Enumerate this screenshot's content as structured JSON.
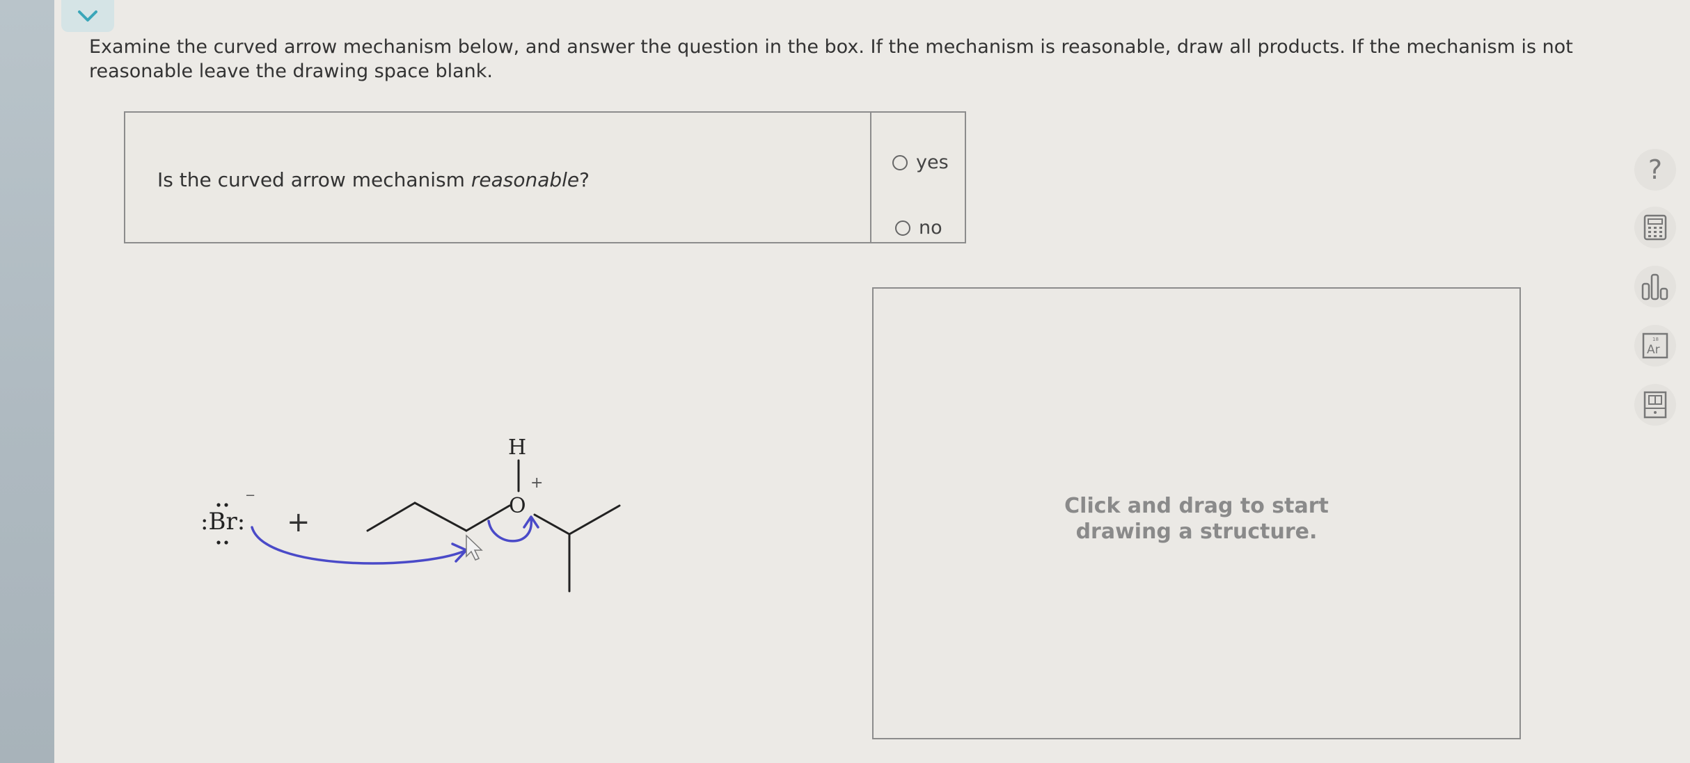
{
  "instructions": "Examine the curved arrow mechanism below, and answer the question in the box. If the mechanism is reasonable, draw all products. If the mechanism is not reasonable leave the drawing space blank.",
  "question": {
    "prefix": "Is the curved arrow mechanism ",
    "emphasis": "reasonable",
    "suffix": "?",
    "options": [
      {
        "label": "yes",
        "selected": false
      },
      {
        "label": "no",
        "selected": false
      }
    ]
  },
  "mechanism": {
    "bromide": ":Br:",
    "bromide_charge": "−",
    "plus_sign": "+",
    "hydrogen": "H",
    "oxygen": "O",
    "oxygen_charge": "+"
  },
  "drawing_area": {
    "prompt_line1": "Click and drag to start",
    "prompt_line2": "drawing a structure."
  },
  "toolbar": {
    "help_label": "?",
    "periodic_symbol": "Ar",
    "periodic_number": "18"
  },
  "colors": {
    "arrow": "#4a4ac8",
    "tab": "#d5e4e6",
    "chevron": "#3aa6b9"
  },
  "icons": [
    "chevron-down-icon",
    "help-icon",
    "calculator-icon",
    "bar-chart-icon",
    "periodic-table-icon",
    "reference-book-icon"
  ]
}
